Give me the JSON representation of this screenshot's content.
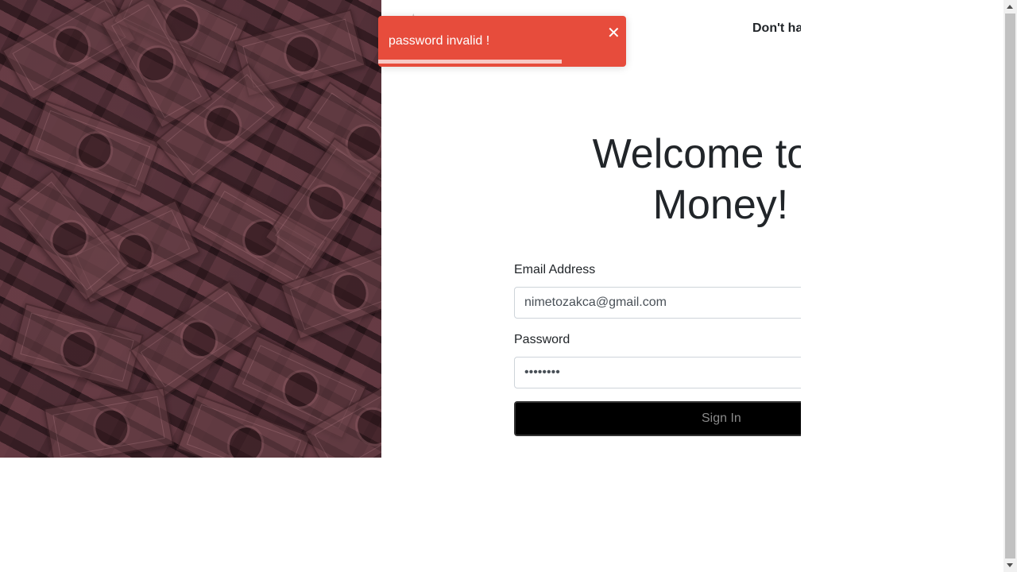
{
  "header": {
    "logo_text": "★",
    "signup_link": "Don't ha"
  },
  "main": {
    "welcome_line1": "Welcome to B",
    "welcome_line2": "Money!"
  },
  "form": {
    "email_label": "Email Address",
    "email_value": "nimetozakca@gmail.com",
    "password_label": "Password",
    "password_value": "password",
    "signin_label": "Sign In"
  },
  "toast": {
    "message": "password invalid !",
    "close_icon": "✕",
    "progress": 0.74,
    "color": "#e74c3c"
  },
  "hero": {
    "image": "dollar-bills-background"
  }
}
